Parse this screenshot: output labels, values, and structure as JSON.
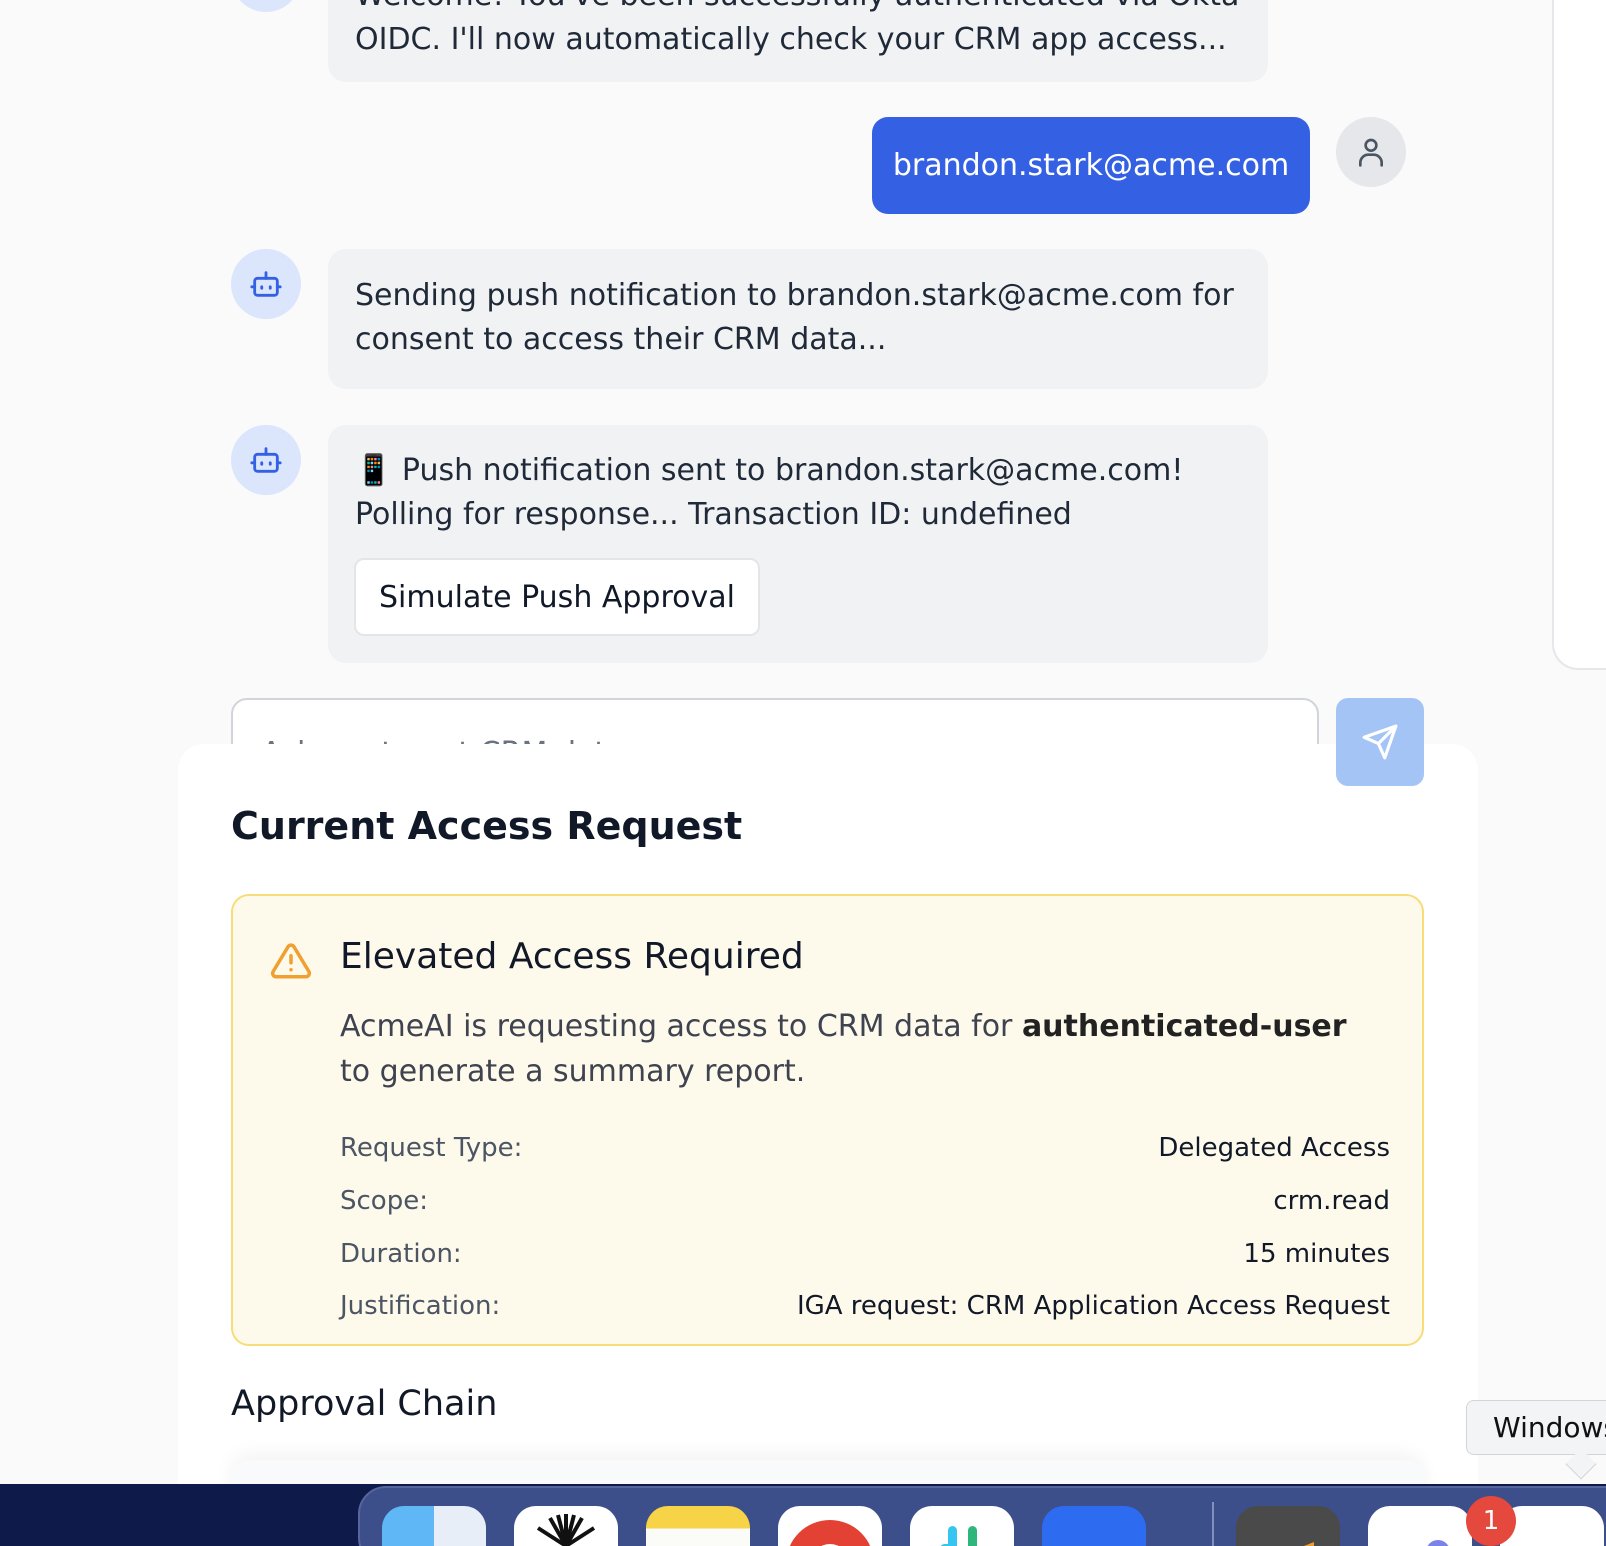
{
  "chat": {
    "top_message_partial": "Welcome! You've been successfully authenticated via Okta",
    "top_message_line2": "OIDC. I'll now automatically check your CRM app access...",
    "user_email_message": "brandon.stark@acme.com",
    "msg_sending_push": "Sending push notification to brandon.stark@acme.com for consent to access their CRM data...",
    "msg_push_sent_line1": "📱 Push notification sent to brandon.stark@acme.com!",
    "msg_push_sent_line2": "Polling for response... Transaction ID: undefined",
    "simulate_button": "Simulate Push Approval",
    "input_placeholder": "Ask me to get CRM data..."
  },
  "access_request": {
    "title": "Current Access Request",
    "alert_title": "Elevated Access Required",
    "desc_prefix": "AcmeAI is requesting access to CRM data for ",
    "desc_user": "authenticated-user",
    "desc_suffix": " to generate a summary report.",
    "details": [
      {
        "label": "Request Type:",
        "value": "Delegated Access"
      },
      {
        "label": "Scope:",
        "value": "crm.read"
      },
      {
        "label": "Duration:",
        "value": "15 minutes"
      },
      {
        "label": "Justification:",
        "value": "IGA request: CRM Application Access Request"
      }
    ],
    "approval_chain_title": "Approval Chain"
  },
  "dock": {
    "tooltip": "Windows",
    "badge_count": "1",
    "apps": [
      "finder-icon",
      "perplexity-icon",
      "notes-icon",
      "chrome-icon",
      "slack-icon",
      "zoom-icon",
      "sublime-icon",
      "teams-icon",
      "windows-app-icon"
    ]
  },
  "colors": {
    "primary": "#3461e3",
    "send_button": "#a4c4f6",
    "alert_bg": "#fefaeb",
    "alert_border": "#f8dc7a",
    "warning_icon": "#f0a030"
  }
}
